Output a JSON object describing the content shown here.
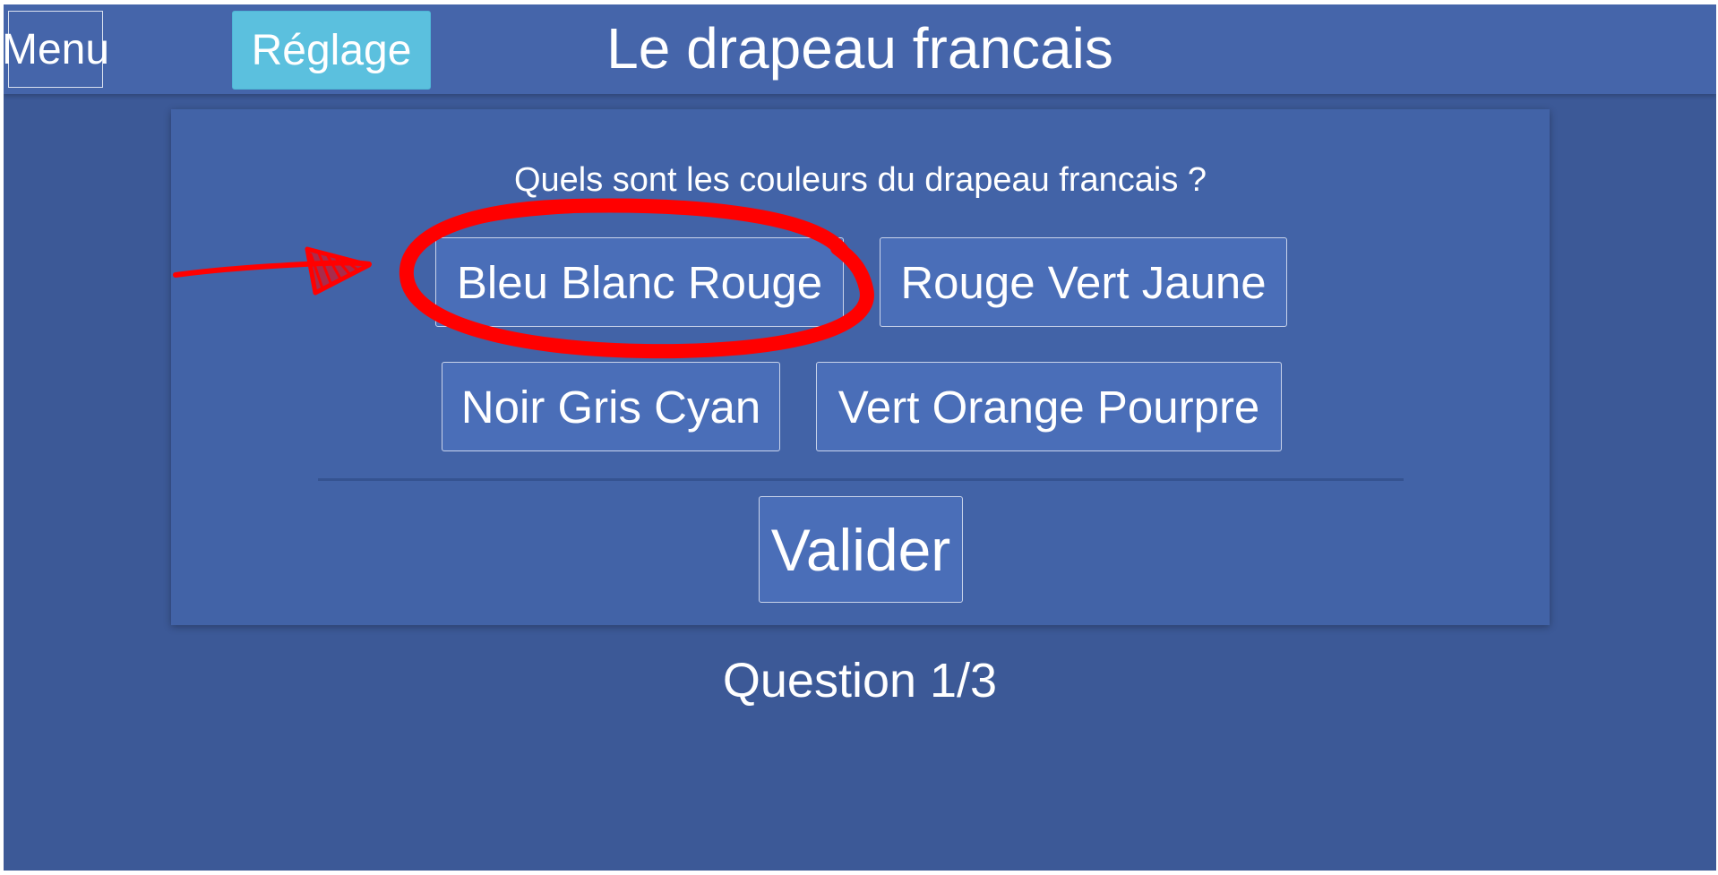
{
  "topbar": {
    "menu_label": "Menu",
    "settings_label": "Réglage",
    "title": "Le drapeau francais"
  },
  "quiz": {
    "question": "Quels sont les couleurs du drapeau francais ?",
    "answers": [
      "Bleu Blanc Rouge",
      "Rouge Vert Jaune",
      "Noir Gris Cyan",
      "Vert Orange Pourpre"
    ],
    "submit_label": "Valider",
    "progress": "Question 1/3"
  },
  "colors": {
    "background": "#3c5997",
    "topbar": "#4565aa",
    "panel": "#4263a7",
    "button": "#4a6eb8",
    "settings_button": "#5bc0de",
    "annotation": "#ff0000"
  }
}
